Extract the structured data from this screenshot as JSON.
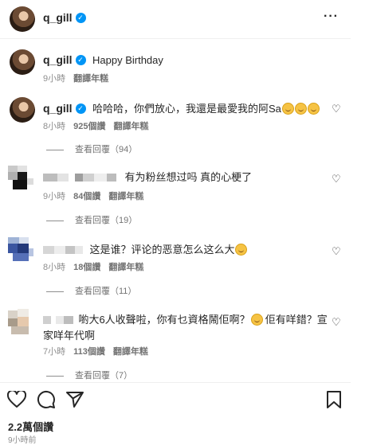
{
  "post": {
    "username": "q_gill",
    "more_label": "···"
  },
  "caption": {
    "username": "q_gill",
    "text": "Happy Birthday",
    "time": "9小時",
    "translate": "翻譯年糕"
  },
  "comments": [
    {
      "username": "q_gill",
      "text": "哈哈哈，你們放心，我還是最愛我的阿Sa",
      "time": "8小時",
      "likes": "925個讚",
      "reply": "翻譯年糕",
      "view_replies": "查看回覆（94）"
    },
    {
      "text": "有为粉丝想过吗 真的心梗了",
      "time": "9小時",
      "likes": "84個讚",
      "reply": "翻譯年糕",
      "view_replies": "查看回覆（19）"
    },
    {
      "text": "这是谁？评论的恶意怎么这么大",
      "time": "8小時",
      "likes": "18個讚",
      "reply": "翻譯年糕",
      "view_replies": "查看回覆（11）"
    },
    {
      "text_line1": "喲大6人收聲啦，你有乜資格鬧佢啊？",
      "text_line1b": "佢有咩錯？宣",
      "text_line2": "家咩年代啊",
      "time": "7小時",
      "likes": "113個讚",
      "reply": "翻譯年糕",
      "view_replies": "查看回覆（7）"
    }
  ],
  "footer": {
    "likes": "2.2萬個讚",
    "time": "9小時前"
  },
  "icons": [
    "heart-icon",
    "comment-icon",
    "share-icon",
    "bookmark-icon",
    "more-icon"
  ]
}
